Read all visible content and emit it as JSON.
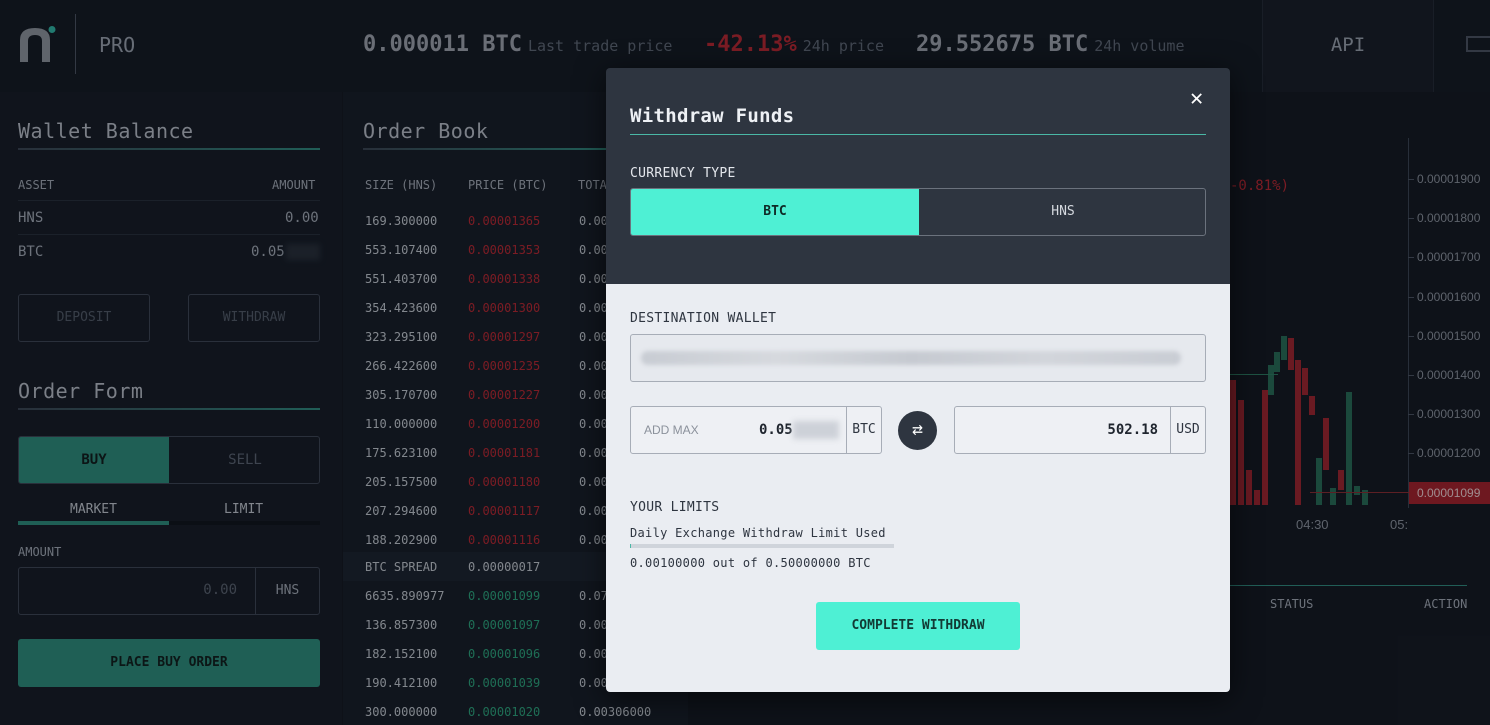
{
  "header": {
    "brand": "PRO",
    "last_trade_value": "0.000011 BTC",
    "last_trade_label": "Last trade price",
    "change_value": "-42.13%",
    "change_label": "24h price",
    "volume_value": "29.552675 BTC",
    "volume_label": "24h volume",
    "api_label": "API"
  },
  "wallet": {
    "title": "Wallet Balance",
    "col_asset": "ASSET",
    "col_amount": "AMOUNT",
    "rows": [
      {
        "asset": "HNS",
        "amount": "0.00"
      },
      {
        "asset": "BTC",
        "amount": "0.05"
      }
    ],
    "deposit_label": "DEPOSIT",
    "withdraw_label": "WITHDRAW"
  },
  "order_form": {
    "title": "Order Form",
    "buy_label": "BUY",
    "sell_label": "SELL",
    "market_label": "MARKET",
    "limit_label": "LIMIT",
    "amount_label": "AMOUNT",
    "amount_placeholder": "0.00",
    "amount_unit": "HNS",
    "place_label": "PLACE BUY ORDER"
  },
  "order_book": {
    "title": "Order Book",
    "col_size": "SIZE (HNS)",
    "col_price": "PRICE (BTC)",
    "col_total": "TOTA",
    "asks": [
      {
        "size": "169.300000",
        "price": "0.00001365",
        "total": "0.00"
      },
      {
        "size": "553.107400",
        "price": "0.00001353",
        "total": "0.00"
      },
      {
        "size": "551.403700",
        "price": "0.00001338",
        "total": "0.00"
      },
      {
        "size": "354.423600",
        "price": "0.00001300",
        "total": "0.00"
      },
      {
        "size": "323.295100",
        "price": "0.00001297",
        "total": "0.00"
      },
      {
        "size": "266.422600",
        "price": "0.00001235",
        "total": "0.00"
      },
      {
        "size": "305.170700",
        "price": "0.00001227",
        "total": "0.00"
      },
      {
        "size": "110.000000",
        "price": "0.00001200",
        "total": "0.00"
      },
      {
        "size": "175.623100",
        "price": "0.00001181",
        "total": "0.00"
      },
      {
        "size": "205.157500",
        "price": "0.00001180",
        "total": "0.00"
      },
      {
        "size": "207.294600",
        "price": "0.00001117",
        "total": "0.00"
      },
      {
        "size": "188.202900",
        "price": "0.00001116",
        "total": "0.00"
      }
    ],
    "spread_label": "BTC SPREAD",
    "spread_value": "0.00000017",
    "bids": [
      {
        "size": "6635.890977",
        "price": "0.00001099",
        "total": "0.07"
      },
      {
        "size": "136.857300",
        "price": "0.00001097",
        "total": "0.00"
      },
      {
        "size": "182.152100",
        "price": "0.00001096",
        "total": "0.00"
      },
      {
        "size": "190.412100",
        "price": "0.00001039",
        "total": "0.00"
      },
      {
        "size": "300.000000",
        "price": "0.00001020",
        "total": "0.00306000"
      }
    ]
  },
  "chart": {
    "change_text": "-0.81%)",
    "price_ticks": [
      "0.00001900",
      "0.00001800",
      "0.00001700",
      "0.00001600",
      "0.00001500",
      "0.00001400",
      "0.00001300",
      "0.00001200"
    ],
    "last_price": "0.00001099",
    "time_ticks": [
      "04:30",
      "05:"
    ],
    "up_color": "#2a7a5e",
    "down_color": "#b9252e"
  },
  "orders_table": {
    "col_status": "STATUS",
    "col_action": "ACTION"
  },
  "modal": {
    "title": "Withdraw Funds",
    "currency_label": "CURRENCY TYPE",
    "currency_options": [
      "BTC",
      "HNS"
    ],
    "destination_label": "DESTINATION WALLET",
    "add_max_label": "ADD MAX",
    "btc_amount": "0.05",
    "btc_unit": "BTC",
    "usd_amount": "502.18",
    "usd_unit": "USD",
    "limits_label": "YOUR LIMITS",
    "limit_desc": "Daily Exchange Withdraw Limit Used",
    "limit_used_fraction": 0.002,
    "limit_text": "0.00100000 out of 0.50000000 BTC",
    "complete_label": "COMPLETE WITHDRAW",
    "accent": "#4ef0d4"
  }
}
